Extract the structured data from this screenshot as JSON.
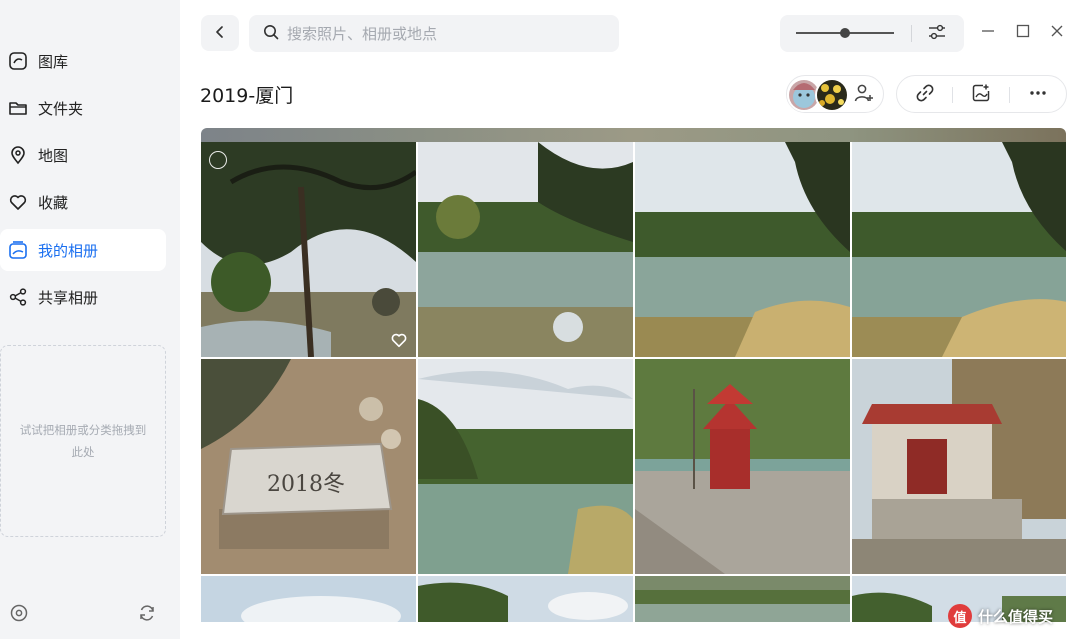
{
  "sidebar": {
    "items": [
      {
        "label": "图库",
        "icon": "gallery-icon"
      },
      {
        "label": "文件夹",
        "icon": "folder-icon"
      },
      {
        "label": "地图",
        "icon": "map-pin-icon"
      },
      {
        "label": "收藏",
        "icon": "heart-icon"
      },
      {
        "label": "我的相册",
        "icon": "album-icon",
        "active": true
      },
      {
        "label": "共享相册",
        "icon": "share-icon"
      }
    ],
    "drop_hint": "试试把相册或分类拖拽到此处"
  },
  "header": {
    "search_placeholder": "搜索照片、相册或地点",
    "zoom_level": 0.5
  },
  "album": {
    "title": "2019-厦门",
    "actions": [
      "link-icon",
      "add-photo-icon",
      "more-icon"
    ]
  },
  "photos": [
    {
      "scene": "riverside banyan tree",
      "favorite": true
    },
    {
      "scene": "river with trees",
      "favorite": false
    },
    {
      "scene": "river reflection",
      "favorite": false
    },
    {
      "scene": "river reflection",
      "favorite": false
    },
    {
      "scene": "stone marked 2018冬",
      "favorite": false
    },
    {
      "scene": "river under clouds",
      "favorite": false
    },
    {
      "scene": "red pagoda shrine",
      "favorite": false
    },
    {
      "scene": "red temple gate",
      "favorite": false
    },
    {
      "scene": "sky",
      "favorite": false
    },
    {
      "scene": "forest hills",
      "favorite": false
    },
    {
      "scene": "village fields",
      "favorite": false
    },
    {
      "scene": "sky and trees",
      "favorite": false
    }
  ],
  "stone_text": "2018冬",
  "watermark": {
    "badge": "值",
    "text": "什么值得买"
  },
  "colors": {
    "accent": "#1a6ff0",
    "sidebar_bg": "#f3f4f6"
  }
}
